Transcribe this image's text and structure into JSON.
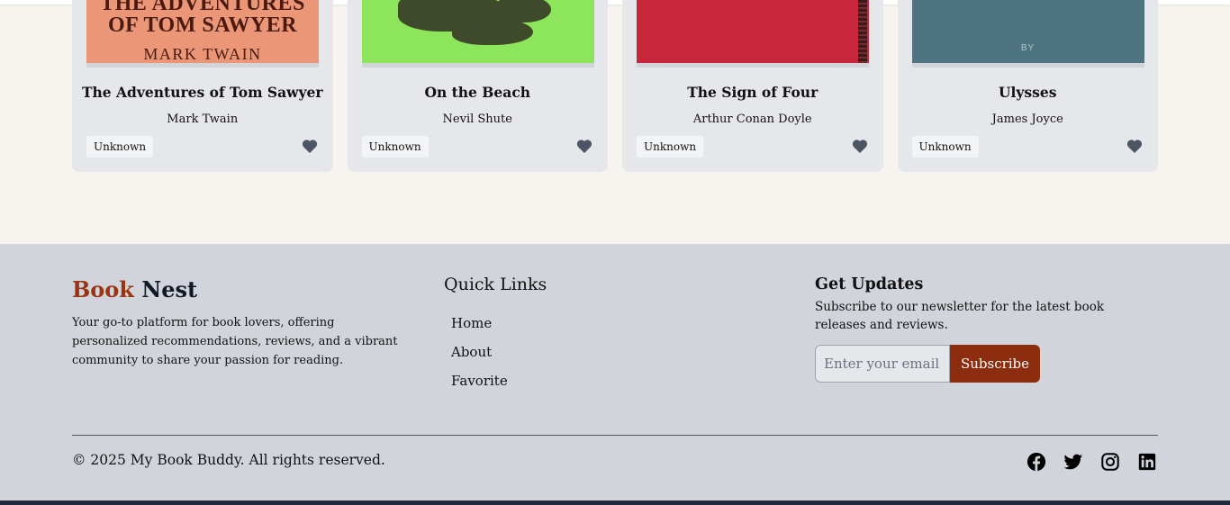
{
  "books": [
    {
      "title": "The Adventures of Tom Sawyer",
      "author": "Mark Twain",
      "status": "Unknown",
      "cover": {
        "color": "#ea9677",
        "line1": "THE ADVENTURES",
        "line2": "OF TOM SAWYER",
        "line3": "MARK TWAIN"
      }
    },
    {
      "title": "On the Beach",
      "author": "Nevil Shute",
      "status": "Unknown",
      "cover": {
        "color": "#8de55b"
      }
    },
    {
      "title": "The Sign of Four",
      "author": "Arthur Conan Doyle",
      "status": "Unknown",
      "cover": {
        "color": "#c8263a"
      }
    },
    {
      "title": "Ulysses",
      "author": "James Joyce",
      "status": "Unknown",
      "cover": {
        "color": "#4d7480",
        "text": "BY"
      }
    }
  ],
  "favorite_icon": "heart-icon",
  "footer": {
    "brand_part1": "Book",
    "brand_part2": "Nest",
    "description": "Your go-to platform for book lovers, offering personalized recommendations, reviews, and a vibrant community to share your passion for reading.",
    "quick_links_title": "Quick Links",
    "links": [
      "Home",
      "About",
      "Favorite"
    ],
    "updates_title": "Get Updates",
    "updates_text": "Subscribe to our newsletter for the latest book releases and reviews.",
    "email_placeholder": "Enter your email",
    "subscribe_label": "Subscribe",
    "copyright": "© 2025 My Book Buddy. All rights reserved.",
    "social_icons": [
      "facebook-icon",
      "twitter-icon",
      "instagram-icon",
      "linkedin-icon"
    ]
  },
  "colors": {
    "accent": "#9a3412",
    "button": "#8b2d0e",
    "footer_bg": "#d1d5db",
    "page_bg": "#f7f4ef",
    "card_bg": "#e5e7eb"
  }
}
